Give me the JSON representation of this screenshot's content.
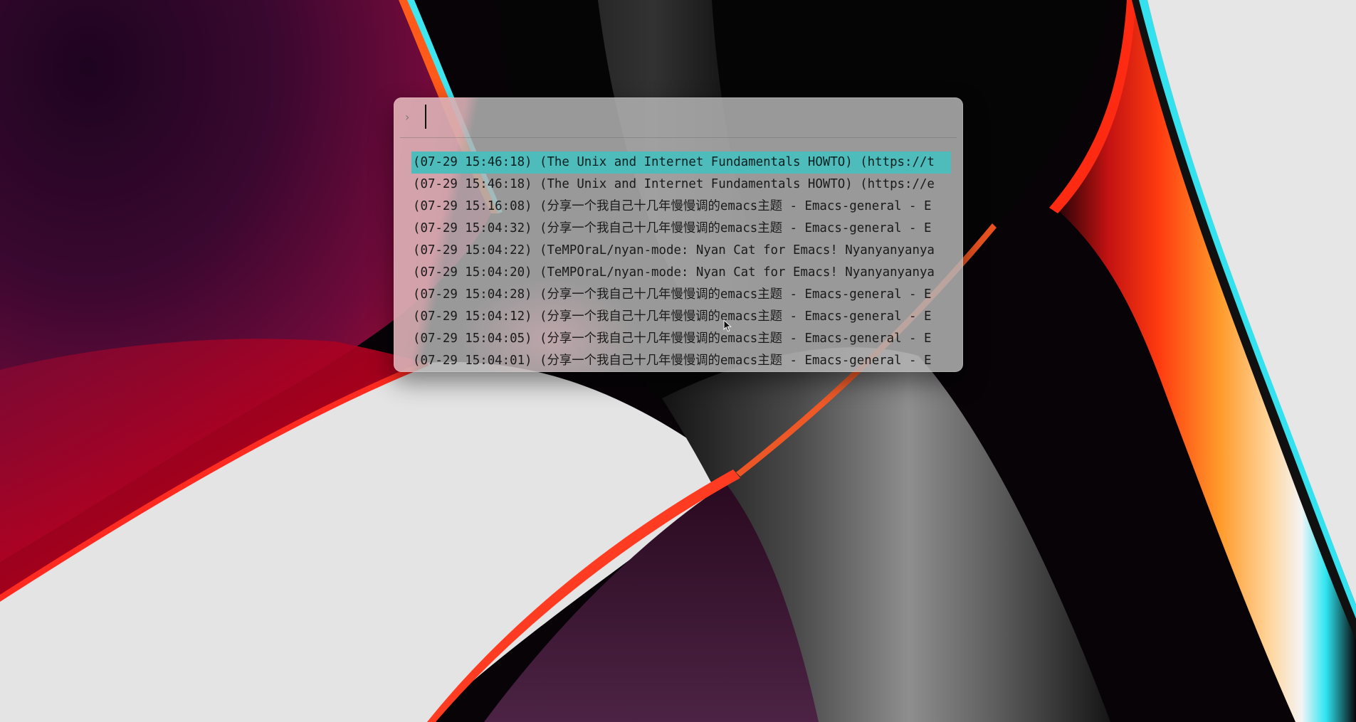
{
  "launcher": {
    "prompt_icon": "chevron-right-icon",
    "input": {
      "value": "",
      "placeholder": ""
    },
    "selected_index": 0,
    "selection_color": "#4fbcbc",
    "results": [
      "(07-29 15:46:18) (The Unix and Internet Fundamentals HOWTO) (https://t",
      "(07-29 15:46:18) (The Unix and Internet Fundamentals HOWTO) (https://e",
      "(07-29 15:16:08) (分享一个我自己十几年慢慢调的emacs主题 - Emacs-general - E",
      "(07-29 15:04:32) (分享一个我自己十几年慢慢调的emacs主题 - Emacs-general - E",
      "(07-29 15:04:22) (TeMPOraL/nyan-mode: Nyan Cat for Emacs! Nyanyanyanya",
      "(07-29 15:04:20) (TeMPOraL/nyan-mode: Nyan Cat for Emacs! Nyanyanyanya",
      "(07-29 15:04:28) (分享一个我自己十几年慢慢调的emacs主题 - Emacs-general - E",
      "(07-29 15:04:12) (分享一个我自己十几年慢慢调的emacs主题 - Emacs-general - E",
      "(07-29 15:04:05) (分享一个我自己十几年慢慢调的emacs主题 - Emacs-general - E",
      "(07-29 15:04:01) (分享一个我自己十几年慢慢调的emacs主题 - Emacs-general - E"
    ]
  },
  "wallpaper": {
    "name": "macos-big-sur-wallpaper",
    "colors": {
      "deep_purple": "#2a0724",
      "crimson": "#c0001e",
      "orange": "#ff8c1a",
      "cyan": "#3ee6f0",
      "light_gray": "#e6e6e6",
      "black": "#050505"
    }
  },
  "pointer": {
    "icon": "mouse-pointer-icon"
  }
}
